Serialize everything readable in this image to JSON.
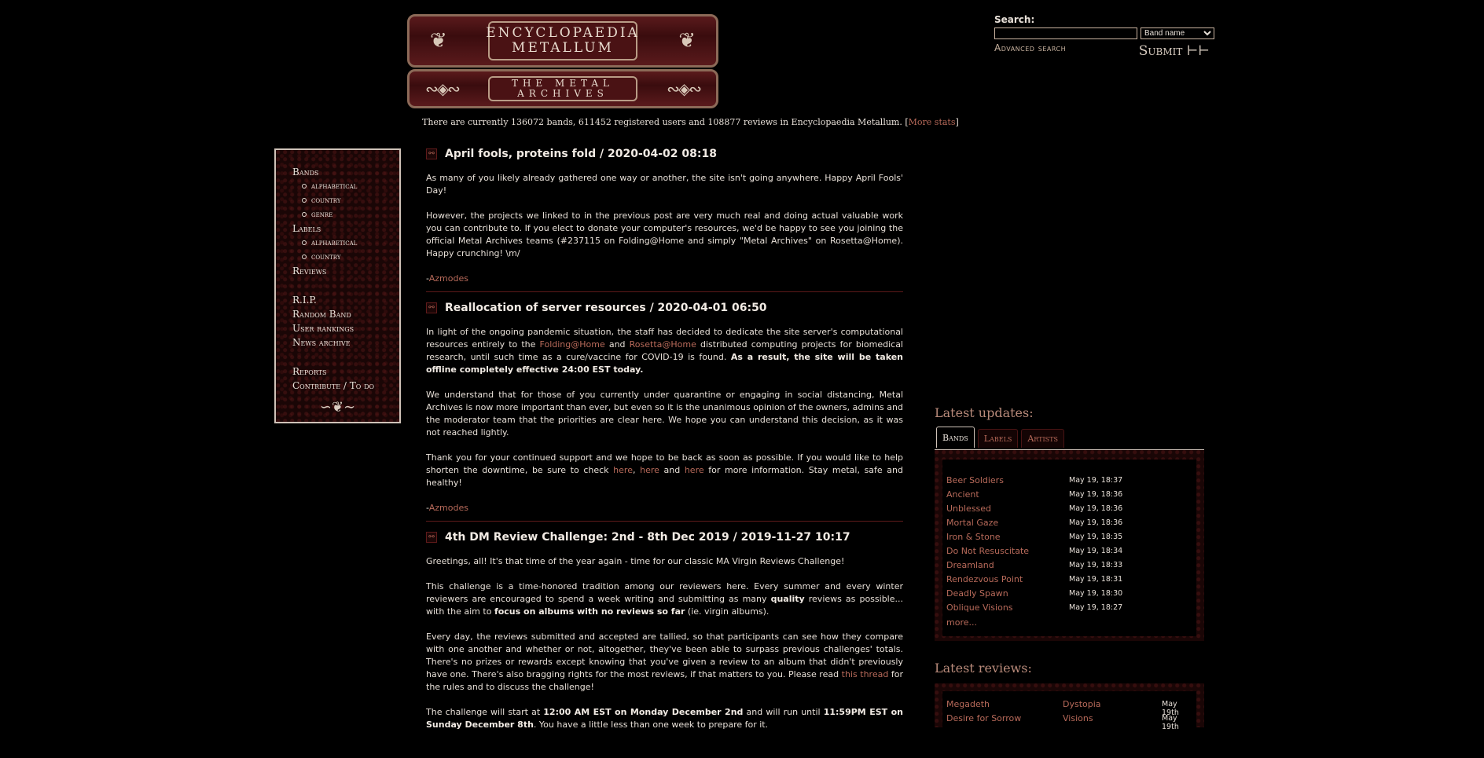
{
  "logo": {
    "top_line1": "ENCYCLOPAEDIA",
    "top_line2": "METALLUM",
    "bottom_line1": "THE METAL",
    "bottom_line2": "ARCHIVES"
  },
  "stats": {
    "text": "There are currently 136072 bands, 611452 registered users and 108877 reviews in Encyclopaedia Metallum. [",
    "link": "More stats",
    "close": "]"
  },
  "search": {
    "label": "Search:",
    "value": "",
    "type_selected": "Band name",
    "advanced": "Advanced search",
    "submit": "Submit ⊢⊢"
  },
  "menu": {
    "bands": "Bands",
    "bands_sub": [
      "alphabetical",
      "country",
      "genre"
    ],
    "labels": "Labels",
    "labels_sub": [
      "alphabetical",
      "country"
    ],
    "reviews": "Reviews",
    "rip": "R.I.P.",
    "random": "Random Band",
    "rankings": "User rankings",
    "archive": "News archive",
    "reports": "Reports",
    "contribute": "Contribute / To do"
  },
  "news": [
    {
      "title": "April fools, proteins fold / 2020-04-02 08:18",
      "p1": "As many of you likely already gathered one way or another, the site isn't going anywhere. Happy April Fools' Day!",
      "p2": "However, the projects we linked to in the previous post are very much real and doing actual valuable work you can contribute to. If you elect to donate your computer's resources, we'd be happy to see you joining the official Metal Archives teams (#237115 on Folding@Home and simply \"Metal Archives\" on Rosetta@Home). Happy crunching! \\m/",
      "sig_dash": "-",
      "sig": "Azmodes"
    },
    {
      "title": "Reallocation of server resources / 2020-04-01 06:50",
      "p1a": "In light of the ongoing pandemic situation, the staff has decided to dedicate the site server's computational resources entirely to the ",
      "p1_link1": "Folding@Home",
      "p1b": " and ",
      "p1_link2": "Rosetta@Home",
      "p1c": " distributed computing projects for biomedical research, until such time as a cure/vaccine for COVID-19 is found. ",
      "p1_bold": "As a result, the site will be taken offline completely effective 24:00 EST today.",
      "p2": "We understand that for those of you currently under quarantine or engaging in social distancing, Metal Archives is now more important than ever, but even so it is the unanimous opinion of the owners, admins and the moderator team that the priorities are clear here. We hope you can understand this decision, as it was not reached lightly.",
      "p3a": "Thank you for your continued support and we hope to be back as soon as possible. If you would like to help shorten the downtime, be sure to check ",
      "here1": "here",
      "comma": ", ",
      "here2": "here",
      "and": " and ",
      "here3": "here",
      "p3b": " for more information. Stay metal, safe and healthy!",
      "sig_dash": "-",
      "sig": "Azmodes"
    },
    {
      "title": "4th DM Review Challenge: 2nd - 8th Dec 2019 / 2019-11-27 10:17",
      "p1": "Greetings, all! It's that time of the year again - time for our classic MA Virgin Reviews Challenge!",
      "p2a": "This challenge is a time-honored tradition among our reviewers here. Every summer and every winter reviewers are encouraged to spend a week writing and submitting as many ",
      "p2_bold1": "quality",
      "p2b": " reviews as possible... with the aim to ",
      "p2_bold2": "focus on albums with no reviews so far",
      "p2c": " (ie. virgin albums).",
      "p3a": "Every day, the reviews submitted and accepted are tallied, so that participants can see how they compare with one another and whether or not, altogether, they've been able to surpass previous challenges' totals. There's no prizes or rewards except knowing that you've given a review to an album that didn't previously have one. There's also bragging rights for the most reviews, if that matters to you. Please read ",
      "p3_link": "this thread",
      "p3b": " for the rules and to discuss the challenge!",
      "p4a": "The challenge will start at ",
      "p4_bold1": "12:00 AM EST on Monday December 2nd",
      "p4b": " and will run until ",
      "p4_bold2": "11:59PM EST on Sunday December 8th",
      "p4c": ". You have a little less than one week to prepare for it."
    }
  ],
  "updates": {
    "heading": "Latest updates:",
    "tabs": [
      "Bands",
      "Labels",
      "Artists"
    ],
    "active_tab": "Bands",
    "rows": [
      {
        "name": "Beer Soldiers",
        "time": "May 19, 18:37"
      },
      {
        "name": "Ancient",
        "time": "May 19, 18:36"
      },
      {
        "name": "Unblessed",
        "time": "May 19, 18:36"
      },
      {
        "name": "Mortal Gaze",
        "time": "May 19, 18:36"
      },
      {
        "name": "Iron & Stone",
        "time": "May 19, 18:35"
      },
      {
        "name": "Do Not Resuscitate",
        "time": "May 19, 18:34"
      },
      {
        "name": "Dreamland",
        "time": "May 19, 18:33"
      },
      {
        "name": "Rendezvous Point",
        "time": "May 19, 18:31"
      },
      {
        "name": "Deadly Spawn",
        "time": "May 19, 18:30"
      },
      {
        "name": "Oblique Visions",
        "time": "May 19, 18:27"
      }
    ],
    "more": "more..."
  },
  "reviews": {
    "heading": "Latest reviews:",
    "rows": [
      {
        "band": "Megadeth",
        "album": "Dystopia",
        "date": "May 19th"
      },
      {
        "band": "Desire for Sorrow",
        "album": "Visions",
        "date": "May 19th"
      }
    ]
  }
}
